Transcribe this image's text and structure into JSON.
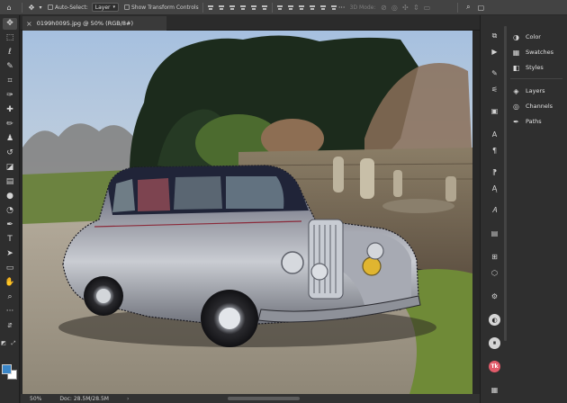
{
  "options_bar": {
    "auto_select_label": "Auto-Select:",
    "auto_select_value": "Layer",
    "show_transform_label": "Show Transform Controls",
    "mode_3d_label": "3D Mode:"
  },
  "document": {
    "tab_title": "0199h0095.jpg @ 50% (RGB/8#)",
    "photo_description": "vintage silver car parked on gravel by stone wall"
  },
  "status_bar": {
    "zoom": "50%",
    "doc_info": "Doc: 28.5M/28.5M"
  },
  "panels": [
    {
      "icon": "color-icon",
      "label": "Color"
    },
    {
      "icon": "swatches-icon",
      "label": "Swatches"
    },
    {
      "icon": "styles-icon",
      "label": "Styles"
    },
    {
      "icon": "layers-icon",
      "label": "Layers"
    },
    {
      "icon": "channels-icon",
      "label": "Channels"
    },
    {
      "icon": "paths-icon",
      "label": "Paths"
    }
  ],
  "colors": {
    "foreground": "#3a86c8",
    "background": "#ffffff",
    "ui_dark": "#262626",
    "ui_panel": "#2f2f2f"
  }
}
